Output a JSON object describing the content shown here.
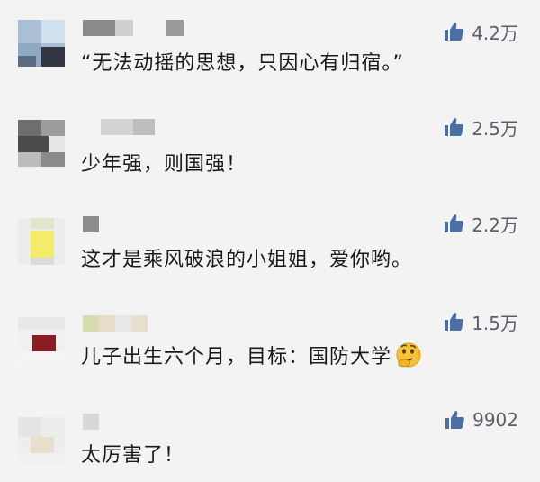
{
  "colors": {
    "background": "#f3f3f3",
    "text": "#1a1a1a",
    "like_icon": "#4a6fa5",
    "like_count": "#5a5f6a"
  },
  "comments": [
    {
      "text": "“无法动摇的思想，只因心有归宿。”",
      "likes": "4.2万",
      "like_icon": "thumbs-up-icon"
    },
    {
      "text": "少年强，则国强！",
      "likes": "2.5万",
      "like_icon": "thumbs-up-icon"
    },
    {
      "text": "这才是乘风破浪的小姐姐，爱你哟。",
      "likes": "2.2万",
      "like_icon": "thumbs-up-icon"
    },
    {
      "text": "儿子出生六个月，目标：国防大学",
      "likes": "1.5万",
      "like_icon": "thumbs-up-icon",
      "emoji": "thinking-face-emoji"
    },
    {
      "text": "太厉害了！",
      "likes": "9902",
      "like_icon": "thumbs-up-icon"
    }
  ]
}
